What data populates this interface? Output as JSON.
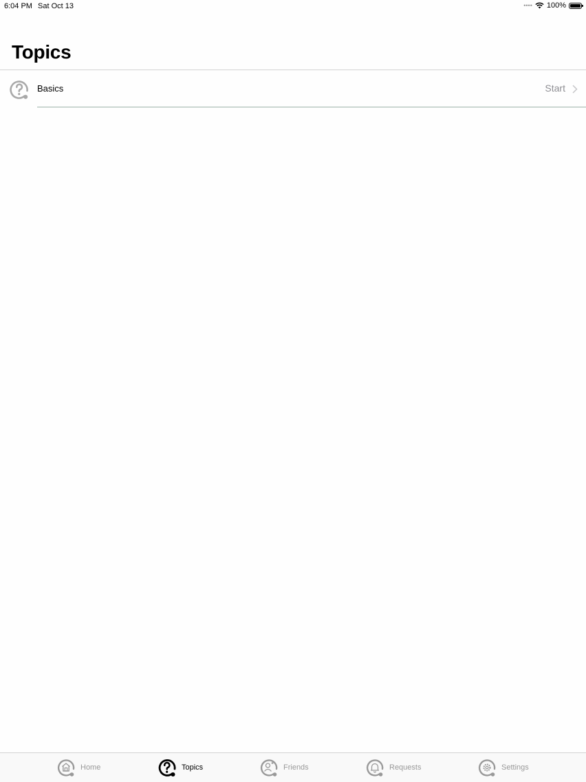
{
  "status_bar": {
    "time": "6:04 PM",
    "date": "Sat Oct 13",
    "battery": "100%",
    "icons": [
      "signal-dots-icon",
      "wifi-icon",
      "battery-icon"
    ]
  },
  "header": {
    "title": "Topics"
  },
  "topics": [
    {
      "label": "Basics",
      "action": "Start",
      "icon": "question-mark-icon"
    }
  ],
  "tab_bar": {
    "active": "Topics",
    "tabs": [
      {
        "label": "Home",
        "icon": "home-icon"
      },
      {
        "label": "Topics",
        "icon": "question-mark-icon"
      },
      {
        "label": "Friends",
        "icon": "friends-icon"
      },
      {
        "label": "Requests",
        "icon": "bell-icon"
      },
      {
        "label": "Settings",
        "icon": "gear-icon"
      }
    ]
  },
  "colors": {
    "background": "#fefefe",
    "inactive_gray": "#999999",
    "active_black": "#000000",
    "divider": "#d3d3d3",
    "row_divider": "#9bb0a8"
  }
}
